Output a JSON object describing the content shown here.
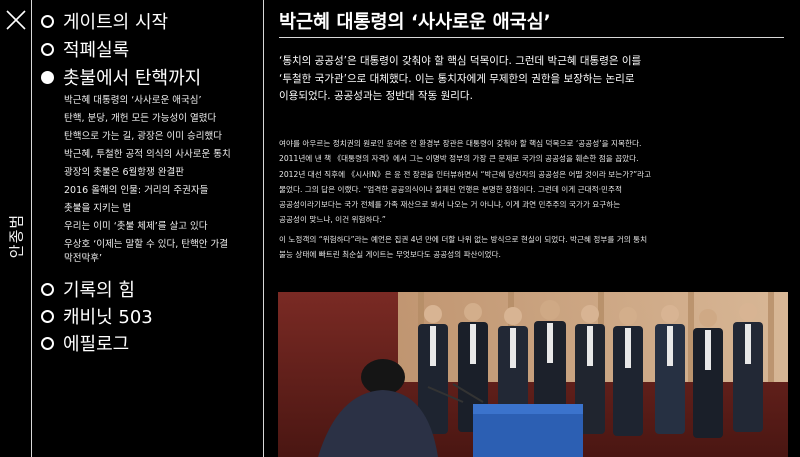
{
  "sidebar": {
    "author": "안종범"
  },
  "toc": {
    "chapters": [
      {
        "label": "게이트의 시작",
        "active": false
      },
      {
        "label": "적폐실록",
        "active": false
      },
      {
        "label": "촛불에서 탄핵까지",
        "active": true
      }
    ],
    "sub_items": [
      "박근혜 대통령의 ‘사사로운 애국심’",
      "탄핵, 분당, 개헌 모든 가능성이 열렸다",
      "탄핵으로 가는 길, 광장은 이미 승리했다",
      "박근혜, 투철한 공적 의식의 사사로운 통치",
      "광장의 촛불은 6월항쟁 완결판",
      "2016 올해의 인물: 거리의 주권자들",
      "촛불을 지키는 법",
      "우리는 이미 ‘촛불 체제’를 살고 있다",
      "우상호 ‘이제는 말할 수 있다, 탄핵안 가결",
      "막전막후’"
    ],
    "chapters_after": [
      {
        "label": "기록의 힘",
        "active": false
      },
      {
        "label": "캐비닛 503",
        "active": false
      },
      {
        "label": "에필로그",
        "active": false
      }
    ]
  },
  "article": {
    "title": "박근혜 대통령의 ‘사사로운 애국심’",
    "lead": [
      "‘통치의 공공성’은 대통령이 갖춰야 할 핵심 덕목이다. 그런데 박근혜 대통령은 이를",
      "‘투철한 국가관’으로 대체했다. 이는 통치자에게 무제한의 권한을 보장하는 논리로",
      "이용되었다. 공공성과는 정반대 작동 원리다."
    ],
    "paragraph1": [
      "여야를 아우르는 정치권의 원로인 윤여준 전 환경부 장관은 대통령이 갖춰야 할 핵심 덕목으로 ‘공공성’을 지목한다.",
      "2011년에 낸 책 《대통령의 자격》에서 그는 이명박 정부의 가장 큰 문제로 국가의 공공성을 훼손한 점을 꼽았다.",
      "2012년 대선 직후에 《시사IN》은 윤 전 장관을 인터뷰하면서 “박근혜 당선자의 공공성은 어떨 것이라 보는가?”라고",
      "물었다. 그의 답은 이랬다. “엄격한 공공의식이나 절제된 언행은 분명한 장점이다. 그런데 이게 근대적·민주적",
      "공공성이라기보다는 국가 전체를 가족 재산으로 봐서 나오는 거 아니냐, 이게 과연 민주주의 국가가 요구하는",
      "공공성이 맞느냐, 이건 위험하다.”"
    ],
    "paragraph2": [
      "이 노정객의 “위험하다”라는 예언은 집권 4년 만에 더할 나위 없는 방식으로 현실이 되었다. 박근혜 정부를 거의 통치",
      "불능 상태에 빠트린 최순실 게이트는 무엇보다도 공공성의 파산이었다."
    ]
  },
  "colors": {
    "background": "#000000",
    "text": "#ffffff",
    "divider": "#d8d8d8"
  },
  "icons": {
    "close": "close-icon"
  }
}
